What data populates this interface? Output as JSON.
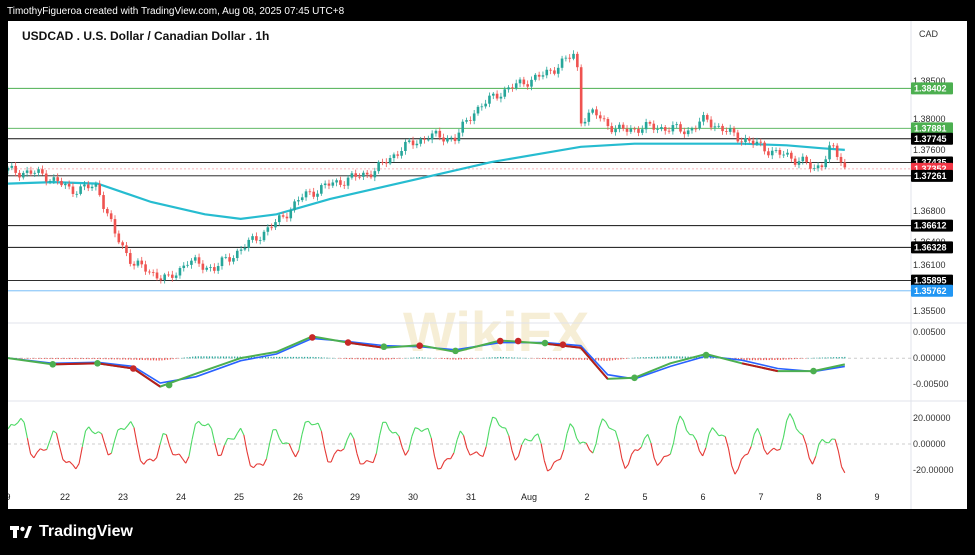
{
  "credit": "TimothyFigueroa created with TradingView.com, Aug 08, 2025 07:45 UTC+8",
  "footer": {
    "brand": "TradingView"
  },
  "watermark": "WikiFX",
  "chart_data": [
    {
      "type": "line",
      "panel": "price",
      "title": "USDCAD . U.S. Dollar / Canadian Dollar . 1h",
      "currency": "CAD",
      "x_labels": [
        "9",
        "22",
        "23",
        "24",
        "25",
        "26",
        "29",
        "30",
        "31",
        "Aug",
        "2",
        "5",
        "6",
        "7",
        "8",
        "9"
      ],
      "y_ticks": [
        "1.38500",
        "1.38000",
        "1.37600",
        "1.36800",
        "1.36400",
        "1.36100",
        "1.35500"
      ],
      "ylim": [
        1.3542,
        1.3902
      ],
      "horizontal_levels": [
        {
          "label": "1.38402",
          "value": 1.38402,
          "color": "#4caf50"
        },
        {
          "label": "1.37881",
          "value": 1.37881,
          "color": "#4caf50"
        },
        {
          "label": "1.37745",
          "value": 1.37745,
          "color": "#000000"
        },
        {
          "label": "1.37435",
          "value": 1.37435,
          "color": "#000000"
        },
        {
          "label": "1.37352",
          "value": 1.37352,
          "color": "#f23645"
        },
        {
          "label": "1.37261",
          "value": 1.37261,
          "color": "#000000"
        },
        {
          "label": "1.36612",
          "value": 1.36612,
          "color": "#000000"
        },
        {
          "label": "1.36328",
          "value": 1.36328,
          "color": "#000000"
        },
        {
          "label": "1.35895",
          "value": 1.35895,
          "color": "#000000"
        },
        {
          "label": "1.35762",
          "value": 1.35762,
          "color": "#2196f3"
        }
      ],
      "price_path": [
        [
          0,
          1.3733
        ],
        [
          0.04,
          1.3728
        ],
        [
          0.07,
          1.3708
        ],
        [
          0.1,
          1.3712
        ],
        [
          0.12,
          1.3648
        ],
        [
          0.14,
          1.3612
        ],
        [
          0.16,
          1.36
        ],
        [
          0.18,
          1.359
        ],
        [
          0.2,
          1.3615
        ],
        [
          0.23,
          1.3605
        ],
        [
          0.26,
          1.363
        ],
        [
          0.3,
          1.3665
        ],
        [
          0.33,
          1.37
        ],
        [
          0.36,
          1.3715
        ],
        [
          0.39,
          1.3725
        ],
        [
          0.41,
          1.3733
        ],
        [
          0.44,
          1.3762
        ],
        [
          0.47,
          1.3778
        ],
        [
          0.5,
          1.3775
        ],
        [
          0.52,
          1.381
        ],
        [
          0.55,
          1.3835
        ],
        [
          0.58,
          1.385
        ],
        [
          0.6,
          1.3858
        ],
        [
          0.62,
          1.3875
        ],
        [
          0.635,
          1.3885
        ],
        [
          0.64,
          1.38
        ],
        [
          0.655,
          1.3808
        ],
        [
          0.68,
          1.3785
        ],
        [
          0.72,
          1.379
        ],
        [
          0.76,
          1.3785
        ],
        [
          0.78,
          1.38
        ],
        [
          0.8,
          1.3785
        ],
        [
          0.83,
          1.377
        ],
        [
          0.86,
          1.3755
        ],
        [
          0.89,
          1.3745
        ],
        [
          0.9,
          1.3732
        ],
        [
          0.91,
          1.3745
        ],
        [
          0.92,
          1.3765
        ],
        [
          0.93,
          1.3745
        ],
        [
          0.935,
          1.3735
        ]
      ],
      "ema_path": [
        [
          0,
          1.3716
        ],
        [
          0.05,
          1.3718
        ],
        [
          0.1,
          1.3716
        ],
        [
          0.16,
          1.3692
        ],
        [
          0.22,
          1.3676
        ],
        [
          0.26,
          1.367
        ],
        [
          0.3,
          1.3676
        ],
        [
          0.36,
          1.3696
        ],
        [
          0.42,
          1.3712
        ],
        [
          0.48,
          1.3728
        ],
        [
          0.54,
          1.3744
        ],
        [
          0.6,
          1.3756
        ],
        [
          0.64,
          1.3764
        ],
        [
          0.7,
          1.3768
        ],
        [
          0.76,
          1.3768
        ],
        [
          0.82,
          1.3768
        ],
        [
          0.87,
          1.3766
        ],
        [
          0.91,
          1.3762
        ],
        [
          0.935,
          1.376
        ]
      ]
    },
    {
      "type": "line",
      "panel": "macd",
      "y_ticks": [
        "0.00500",
        "0.00000",
        "-0.00500"
      ],
      "ylim": [
        -0.0075,
        0.0062
      ],
      "macd_path": [
        [
          0,
          0.0
        ],
        [
          0.05,
          -0.0012
        ],
        [
          0.1,
          -0.001
        ],
        [
          0.14,
          -0.002
        ],
        [
          0.17,
          -0.0055
        ],
        [
          0.21,
          -0.003
        ],
        [
          0.26,
          0.0
        ],
        [
          0.3,
          0.0012
        ],
        [
          0.34,
          0.0042
        ],
        [
          0.38,
          0.003
        ],
        [
          0.42,
          0.002
        ],
        [
          0.46,
          0.0025
        ],
        [
          0.5,
          0.0012
        ],
        [
          0.55,
          0.0034
        ],
        [
          0.6,
          0.0028
        ],
        [
          0.64,
          0.002
        ],
        [
          0.67,
          -0.004
        ],
        [
          0.7,
          -0.0038
        ],
        [
          0.74,
          -0.001
        ],
        [
          0.78,
          0.0008
        ],
        [
          0.82,
          -0.001
        ],
        [
          0.86,
          -0.0025
        ],
        [
          0.9,
          -0.0025
        ],
        [
          0.935,
          -0.0012
        ]
      ],
      "signal_path": [
        [
          0,
          0.0
        ],
        [
          0.05,
          -0.001
        ],
        [
          0.1,
          -0.0008
        ],
        [
          0.14,
          -0.0016
        ],
        [
          0.17,
          -0.0048
        ],
        [
          0.21,
          -0.0036
        ],
        [
          0.26,
          -0.0005
        ],
        [
          0.3,
          0.0008
        ],
        [
          0.34,
          0.0038
        ],
        [
          0.38,
          0.0032
        ],
        [
          0.42,
          0.0024
        ],
        [
          0.46,
          0.0022
        ],
        [
          0.5,
          0.0016
        ],
        [
          0.55,
          0.003
        ],
        [
          0.6,
          0.003
        ],
        [
          0.64,
          0.0024
        ],
        [
          0.67,
          -0.0032
        ],
        [
          0.7,
          -0.004
        ],
        [
          0.74,
          -0.0016
        ],
        [
          0.78,
          0.0004
        ],
        [
          0.82,
          -0.0004
        ],
        [
          0.86,
          -0.002
        ],
        [
          0.9,
          -0.0026
        ],
        [
          0.935,
          -0.0016
        ]
      ],
      "crossover_markers": [
        [
          0.05,
          -0.0012,
          "#4caf50"
        ],
        [
          0.1,
          -0.001,
          "#4caf50"
        ],
        [
          0.14,
          -0.002,
          "#c62828"
        ],
        [
          0.18,
          -0.0052,
          "#4caf50"
        ],
        [
          0.34,
          0.004,
          "#c62828"
        ],
        [
          0.38,
          0.003,
          "#c62828"
        ],
        [
          0.42,
          0.0022,
          "#4caf50"
        ],
        [
          0.46,
          0.0024,
          "#c62828"
        ],
        [
          0.5,
          0.0014,
          "#4caf50"
        ],
        [
          0.55,
          0.0033,
          "#c62828"
        ],
        [
          0.57,
          0.0033,
          "#c62828"
        ],
        [
          0.6,
          0.0029,
          "#4caf50"
        ],
        [
          0.62,
          0.0026,
          "#c62828"
        ],
        [
          0.7,
          -0.0038,
          "#4caf50"
        ],
        [
          0.78,
          0.0006,
          "#4caf50"
        ],
        [
          0.9,
          -0.0025,
          "#4caf50"
        ]
      ]
    },
    {
      "type": "line",
      "panel": "oscillator",
      "y_ticks": [
        "20.00000",
        "0.00000",
        "-20.00000"
      ],
      "ylim": [
        -30,
        30
      ]
    }
  ]
}
